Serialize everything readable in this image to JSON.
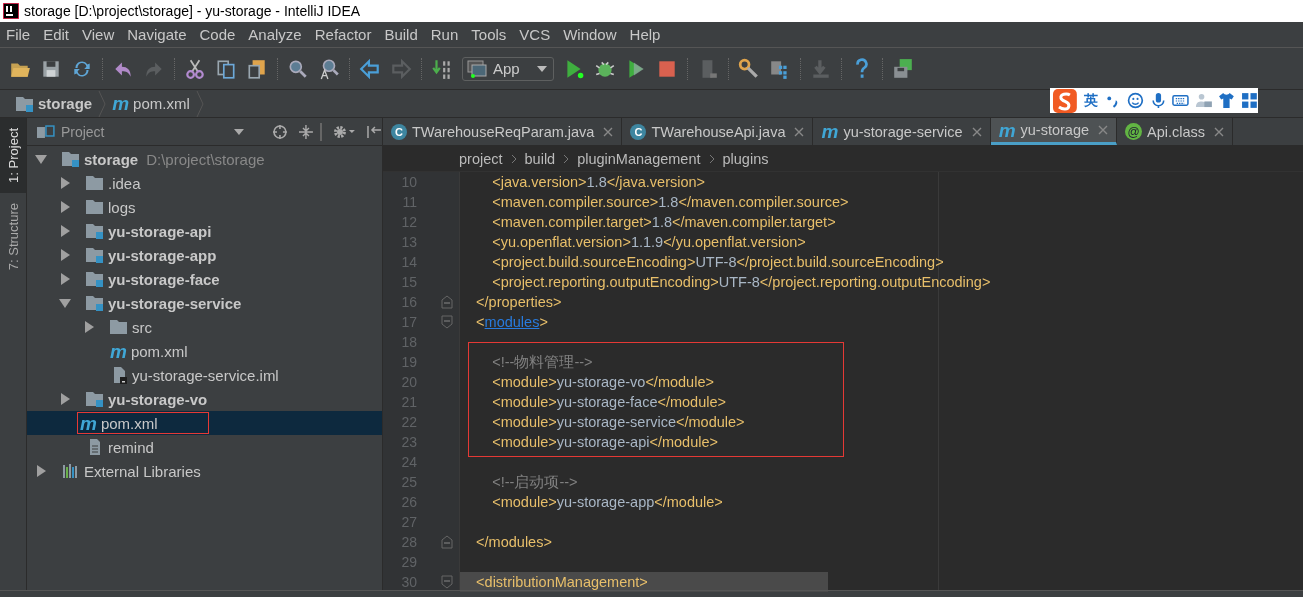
{
  "window": {
    "title": "storage [D:\\project\\storage] - yu-storage - IntelliJ IDEA"
  },
  "menu": [
    "File",
    "Edit",
    "View",
    "Navigate",
    "Code",
    "Analyze",
    "Refactor",
    "Build",
    "Run",
    "Tools",
    "VCS",
    "Window",
    "Help"
  ],
  "toolbar": {
    "run_config": "App"
  },
  "navbar": {
    "crumbs": [
      {
        "label": "storage",
        "kind": "module"
      },
      {
        "label": "pom.xml",
        "kind": "maven",
        "icon_text": "m"
      }
    ]
  },
  "ime": {
    "mode": "英"
  },
  "side_tabs": [
    {
      "label": "1: Project",
      "selected": true
    },
    {
      "label": "7: Structure",
      "selected": false
    }
  ],
  "project_panel": {
    "title": "Project",
    "tree": [
      {
        "label": "storage",
        "path": "D:\\project\\storage",
        "kind": "module",
        "expanded": true,
        "selected": false,
        "boxed": false,
        "children": [
          {
            "label": ".idea",
            "kind": "folder",
            "expanded": false,
            "selected": false,
            "boxed": false
          },
          {
            "label": "logs",
            "kind": "folder",
            "expanded": false,
            "selected": false,
            "boxed": false
          },
          {
            "label": "yu-storage-api",
            "kind": "module",
            "expanded": false,
            "selected": false,
            "boxed": false
          },
          {
            "label": "yu-storage-app",
            "kind": "module",
            "expanded": false,
            "selected": false,
            "boxed": false
          },
          {
            "label": "yu-storage-face",
            "kind": "module",
            "expanded": false,
            "selected": false,
            "boxed": false
          },
          {
            "label": "yu-storage-service",
            "kind": "module",
            "expanded": true,
            "selected": false,
            "boxed": false,
            "children": [
              {
                "label": "src",
                "kind": "folder",
                "expanded": false,
                "selected": false,
                "boxed": false
              },
              {
                "label": "pom.xml",
                "kind": "maven",
                "icon_text": "m",
                "selected": false,
                "boxed": false
              },
              {
                "label": "yu-storage-service.iml",
                "kind": "iml",
                "selected": false,
                "boxed": false
              }
            ]
          },
          {
            "label": "yu-storage-vo",
            "kind": "module",
            "expanded": false,
            "selected": false,
            "boxed": false
          },
          {
            "label": "pom.xml",
            "kind": "maven",
            "icon_text": "m",
            "selected": true,
            "boxed": true
          },
          {
            "label": "remind",
            "kind": "file",
            "selected": false,
            "boxed": false
          }
        ]
      },
      {
        "label": "External Libraries",
        "kind": "libraries",
        "expanded": false,
        "selected": false,
        "boxed": false
      }
    ]
  },
  "editor": {
    "tabs": [
      {
        "label": "TWarehouseReqParam.java",
        "kind": "class",
        "icon_text": "C",
        "selected": false
      },
      {
        "label": "TWarehouseApi.java",
        "kind": "class",
        "icon_text": "C",
        "selected": false
      },
      {
        "label": "yu-storage-service",
        "kind": "maven",
        "icon_text": "m",
        "selected": false
      },
      {
        "label": "yu-storage",
        "kind": "maven",
        "icon_text": "m",
        "selected": true
      },
      {
        "label": "Api.class",
        "kind": "annotation",
        "icon_text": "@",
        "selected": false
      }
    ],
    "breadcrumbs": [
      "project",
      "build",
      "pluginManagement",
      "plugins"
    ],
    "lines": [
      {
        "number": "10",
        "boxed": false,
        "highlighted": false,
        "tokens": [
          {
            "kind": "tag",
            "text": "        <java.version>"
          },
          {
            "kind": "text",
            "text": "1.8"
          },
          {
            "kind": "tag",
            "text": "</java.version>"
          }
        ]
      },
      {
        "number": "11",
        "boxed": false,
        "highlighted": false,
        "tokens": [
          {
            "kind": "tag",
            "text": "        <maven.compiler.source>"
          },
          {
            "kind": "text",
            "text": "1.8"
          },
          {
            "kind": "tag",
            "text": "</maven.compiler.source>"
          }
        ]
      },
      {
        "number": "12",
        "boxed": false,
        "highlighted": false,
        "tokens": [
          {
            "kind": "tag",
            "text": "        <maven.compiler.target>"
          },
          {
            "kind": "text",
            "text": "1.8"
          },
          {
            "kind": "tag",
            "text": "</maven.compiler.target>"
          }
        ]
      },
      {
        "number": "13",
        "boxed": false,
        "highlighted": false,
        "tokens": [
          {
            "kind": "tag",
            "text": "        <yu.openflat.version>"
          },
          {
            "kind": "text",
            "text": "1.1.9"
          },
          {
            "kind": "tag",
            "text": "</yu.openflat.version>"
          }
        ]
      },
      {
        "number": "14",
        "boxed": false,
        "highlighted": false,
        "tokens": [
          {
            "kind": "tag",
            "text": "        <project.build.sourceEncoding>"
          },
          {
            "kind": "text",
            "text": "UTF-8"
          },
          {
            "kind": "tag",
            "text": "</project.build.sourceEncoding>"
          }
        ]
      },
      {
        "number": "15",
        "boxed": false,
        "highlighted": false,
        "tokens": [
          {
            "kind": "tag",
            "text": "        <project.reporting.outputEncoding>"
          },
          {
            "kind": "text",
            "text": "UTF-8"
          },
          {
            "kind": "tag",
            "text": "</project.reporting.outputEncoding>"
          }
        ]
      },
      {
        "number": "16",
        "fold": {
          "kind": "end"
        },
        "boxed": false,
        "highlighted": false,
        "tokens": [
          {
            "kind": "tag",
            "text": "    </properties>"
          }
        ]
      },
      {
        "number": "17",
        "fold": {
          "kind": "start"
        },
        "boxed": false,
        "highlighted": false,
        "tokens": [
          {
            "kind": "tag",
            "text": "    <"
          },
          {
            "kind": "link",
            "text": "modules"
          },
          {
            "kind": "tag",
            "text": ">"
          }
        ]
      },
      {
        "number": "18",
        "boxed": false,
        "highlighted": false
      },
      {
        "number": "19",
        "boxed": true,
        "highlighted": false,
        "tokens": [
          {
            "kind": "comment",
            "text": "        <!--物料管理-->"
          }
        ]
      },
      {
        "number": "20",
        "boxed": true,
        "highlighted": false,
        "tokens": [
          {
            "kind": "tag",
            "text": "        <module>"
          },
          {
            "kind": "text",
            "text": "yu-storage-vo"
          },
          {
            "kind": "tag",
            "text": "</module>"
          }
        ]
      },
      {
        "number": "21",
        "boxed": true,
        "highlighted": false,
        "tokens": [
          {
            "kind": "tag",
            "text": "        <module>"
          },
          {
            "kind": "text",
            "text": "yu-storage-face"
          },
          {
            "kind": "tag",
            "text": "</module>"
          }
        ]
      },
      {
        "number": "22",
        "boxed": true,
        "highlighted": false,
        "tokens": [
          {
            "kind": "tag",
            "text": "        <module>"
          },
          {
            "kind": "text",
            "text": "yu-storage-service"
          },
          {
            "kind": "tag",
            "text": "</module>"
          }
        ]
      },
      {
        "number": "23",
        "boxed": true,
        "highlighted": false,
        "tokens": [
          {
            "kind": "tag",
            "text": "        <module>"
          },
          {
            "kind": "text",
            "text": "yu-storage-api"
          },
          {
            "kind": "tag",
            "text": "</module>"
          }
        ]
      },
      {
        "number": "24",
        "boxed": false,
        "highlighted": false
      },
      {
        "number": "25",
        "boxed": false,
        "highlighted": false,
        "tokens": [
          {
            "kind": "comment",
            "text": "        <!--启动项-->"
          }
        ]
      },
      {
        "number": "26",
        "boxed": false,
        "highlighted": false,
        "tokens": [
          {
            "kind": "tag",
            "text": "        <module>"
          },
          {
            "kind": "text",
            "text": "yu-storage-app"
          },
          {
            "kind": "tag",
            "text": "</module>"
          }
        ]
      },
      {
        "number": "27",
        "boxed": false,
        "highlighted": false
      },
      {
        "number": "28",
        "fold": {
          "kind": "end"
        },
        "boxed": false,
        "highlighted": false,
        "tokens": [
          {
            "kind": "tag",
            "text": "    </modules>"
          }
        ]
      },
      {
        "number": "29",
        "boxed": false,
        "highlighted": false
      },
      {
        "number": "30",
        "fold": {
          "kind": "start"
        },
        "boxed": false,
        "highlighted": true,
        "tokens": [
          {
            "kind": "tag",
            "text": "    <distributionManagement>"
          }
        ]
      }
    ]
  }
}
